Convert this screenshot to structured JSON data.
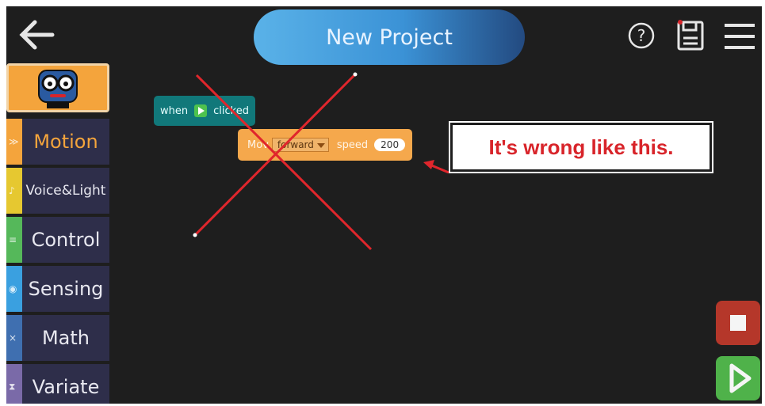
{
  "header": {
    "title": "New Project",
    "back_icon": "back-arrow-icon",
    "help_icon": "question-circle-icon",
    "save_icon": "save-icon",
    "menu_icon": "hamburger-menu-icon"
  },
  "sidebar": {
    "robot_icon": "robot-face-icon",
    "categories": [
      {
        "label": "Motion",
        "color": "#f4a43c",
        "label_color": "#f4a43c"
      },
      {
        "label": "Voice&Light",
        "color": "#e6c830"
      },
      {
        "label": "Control",
        "color": "#55b85a"
      },
      {
        "label": "Sensing",
        "color": "#3aa0e0"
      },
      {
        "label": "Math",
        "color": "#3f6fb0"
      },
      {
        "label": "Variate",
        "color": "#7a6aa8"
      }
    ]
  },
  "blocks": {
    "when": {
      "prefix": "when",
      "suffix": "clicked"
    },
    "move": {
      "label": "Mov",
      "direction": "forward",
      "speed_label": "speed",
      "speed_value": "200"
    }
  },
  "annotation": {
    "text": "It's wrong like this.",
    "color": "#d8242a"
  },
  "controls": {
    "stop_icon": "stop-icon",
    "run_icon": "play-icon",
    "stop_color": "#b5372a",
    "run_color": "#4fb24a"
  }
}
